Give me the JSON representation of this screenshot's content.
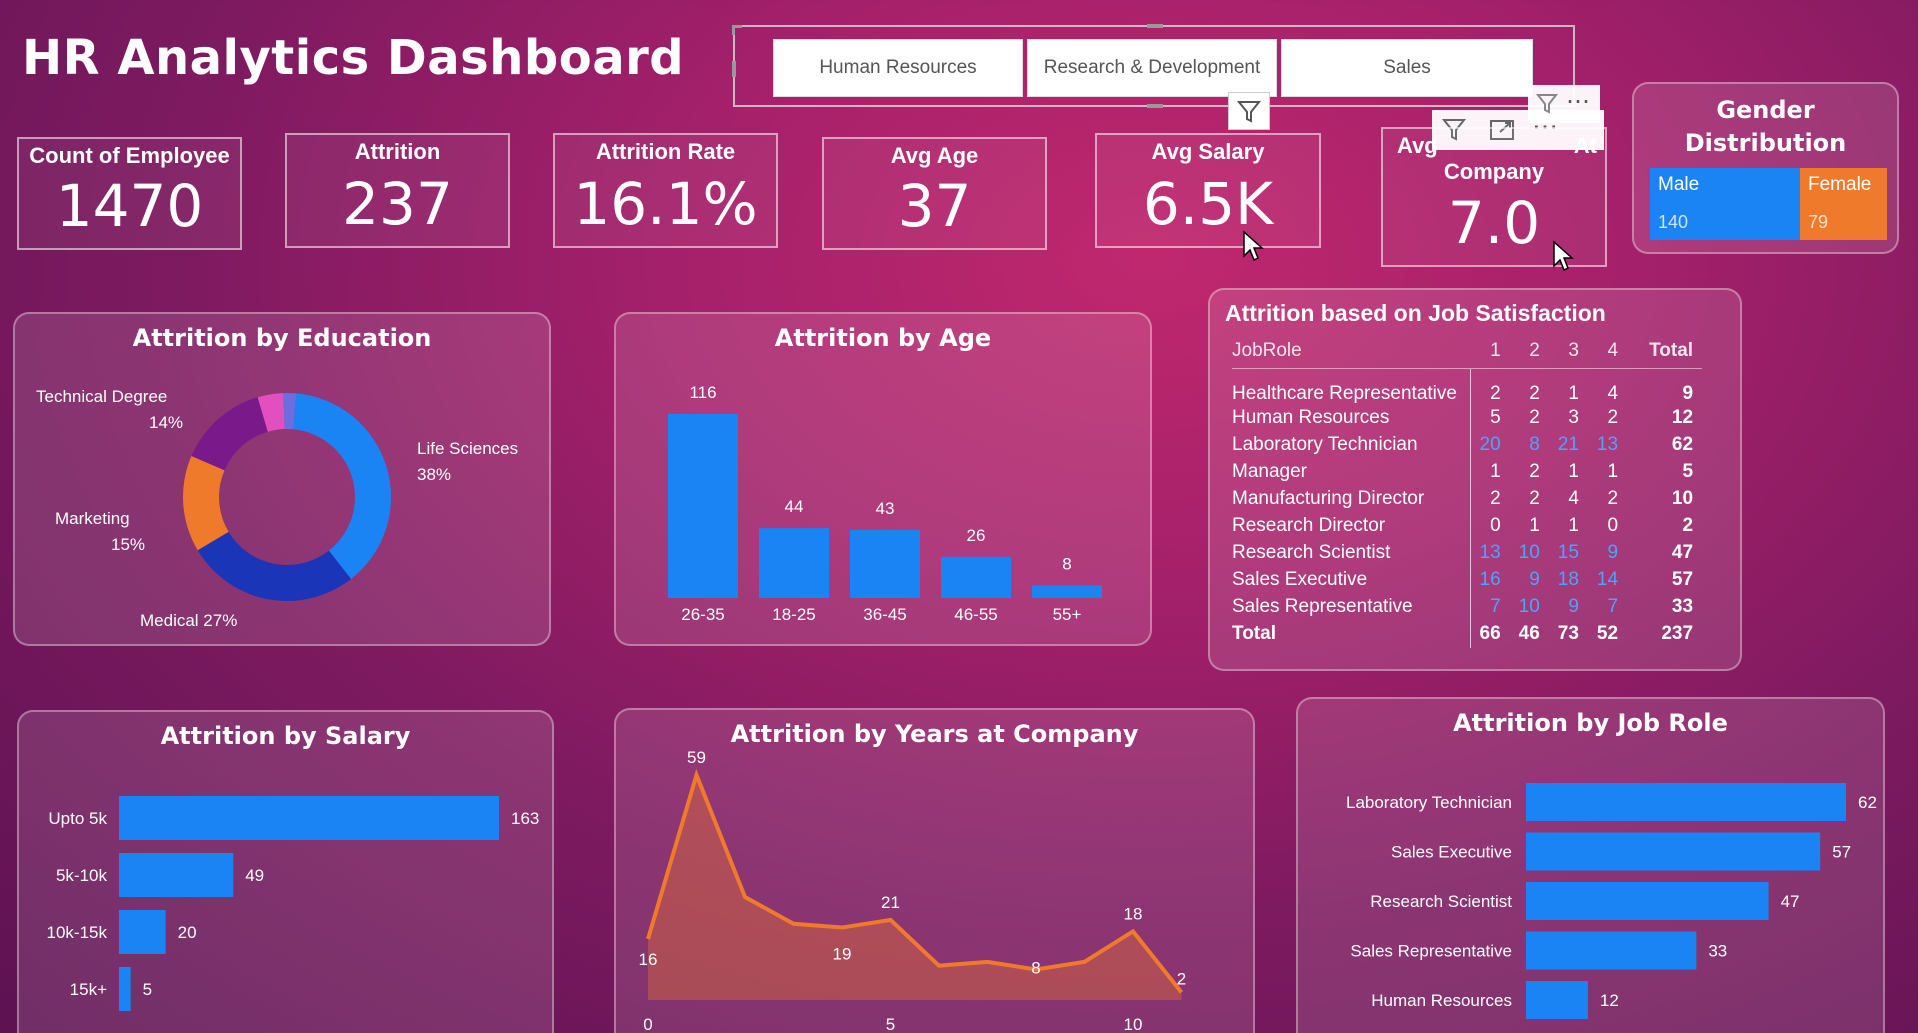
{
  "dashboard_title": "HR Analytics Dashboard",
  "slicer": {
    "options": [
      "Human Resources",
      "Research & Development",
      "Sales"
    ]
  },
  "kpis": [
    {
      "label": "Count of Employee",
      "value": "1470"
    },
    {
      "label": "Attrition",
      "value": "237"
    },
    {
      "label": "Attrition Rate",
      "value": "16.1%"
    },
    {
      "label": "Avg Age",
      "value": "37"
    },
    {
      "label": "Avg Salary",
      "value": "6.5K"
    },
    {
      "label_left": "Avg",
      "label_right": "At",
      "label_line2": "Company",
      "value": "7.0"
    }
  ],
  "gender": {
    "title": "Gender Distribution",
    "male_label": "Male",
    "male_value": "140",
    "female_label": "Female",
    "female_value": "79",
    "colors": {
      "male": "#1a84f5",
      "female": "#f07a2c"
    }
  },
  "colors": {
    "bar": "#1a84f5",
    "area_line": "#f07a2c",
    "donut": [
      "#1a84f5",
      "#1a35b8",
      "#f07a2c",
      "#7a1a8a",
      "#e24fbf",
      "#6a6ee0"
    ]
  },
  "job_satisfaction": {
    "title": "Attrition based on Job Satisfaction",
    "headers": [
      "JobRole",
      "1",
      "2",
      "3",
      "4",
      "Total"
    ],
    "rows": [
      {
        "role": "Healthcare Representative",
        "v": [
          "2",
          "2",
          "1",
          "4"
        ],
        "total": "9"
      },
      {
        "role": "Human Resources",
        "v": [
          "5",
          "2",
          "3",
          "2"
        ],
        "total": "12"
      },
      {
        "role": "Laboratory Technician",
        "v": [
          "20",
          "8",
          "21",
          "13"
        ],
        "total": "62"
      },
      {
        "role": "Manager",
        "v": [
          "1",
          "2",
          "1",
          "1"
        ],
        "total": "5"
      },
      {
        "role": "Manufacturing Director",
        "v": [
          "2",
          "2",
          "4",
          "2"
        ],
        "total": "10"
      },
      {
        "role": "Research Director",
        "v": [
          "0",
          "1",
          "1",
          "0"
        ],
        "total": "2"
      },
      {
        "role": "Research Scientist",
        "v": [
          "13",
          "10",
          "15",
          "9"
        ],
        "total": "47"
      },
      {
        "role": "Sales Executive",
        "v": [
          "16",
          "9",
          "18",
          "14"
        ],
        "total": "57"
      },
      {
        "role": "Sales Representative",
        "v": [
          "7",
          "10",
          "9",
          "7"
        ],
        "total": "33"
      }
    ],
    "total_row": {
      "role": "Total",
      "v": [
        "66",
        "46",
        "73",
        "52"
      ],
      "total": "237"
    }
  },
  "chart_data": [
    {
      "type": "pie",
      "title": "Attrition by Education",
      "series": [
        {
          "name": "Life Sciences",
          "value": 38,
          "label": "38%"
        },
        {
          "name": "Medical",
          "value": 27,
          "label": "27%"
        },
        {
          "name": "Marketing",
          "value": 15,
          "label": "15%"
        },
        {
          "name": "Technical Degree",
          "value": 14,
          "label": "14%"
        },
        {
          "name": "",
          "value": 4,
          "label": ""
        },
        {
          "name": "",
          "value": 2,
          "label": ""
        }
      ]
    },
    {
      "type": "bar",
      "title": "Attrition by Age",
      "categories": [
        "26-35",
        "18-25",
        "36-45",
        "46-55",
        "55+"
      ],
      "values": [
        116,
        44,
        43,
        26,
        8
      ]
    },
    {
      "type": "bar",
      "orientation": "horizontal",
      "title": "Attrition by Salary",
      "categories": [
        "Upto 5k",
        "5k-10k",
        "10k-15k",
        "15k+"
      ],
      "values": [
        163,
        49,
        20,
        5
      ]
    },
    {
      "type": "area",
      "title": "Attrition by Years at Company",
      "x": [
        0,
        1,
        2,
        3,
        4,
        5,
        6,
        7,
        8,
        9,
        10,
        11
      ],
      "values": [
        16,
        59,
        27,
        20,
        19,
        21,
        9,
        10,
        8,
        10,
        18,
        2
      ],
      "point_labels": {
        "0": "16",
        "1": "59",
        "4": "19",
        "5": "21",
        "8": "8",
        "10": "18",
        "11": "2"
      },
      "x_ticks": [
        "0",
        "5",
        "10"
      ]
    },
    {
      "type": "bar",
      "orientation": "horizontal",
      "title": "Attrition by Job Role",
      "categories": [
        "Laboratory Technician",
        "Sales Executive",
        "Research Scientist",
        "Sales Representative",
        "Human Resources"
      ],
      "values": [
        62,
        57,
        47,
        33,
        12
      ]
    }
  ]
}
